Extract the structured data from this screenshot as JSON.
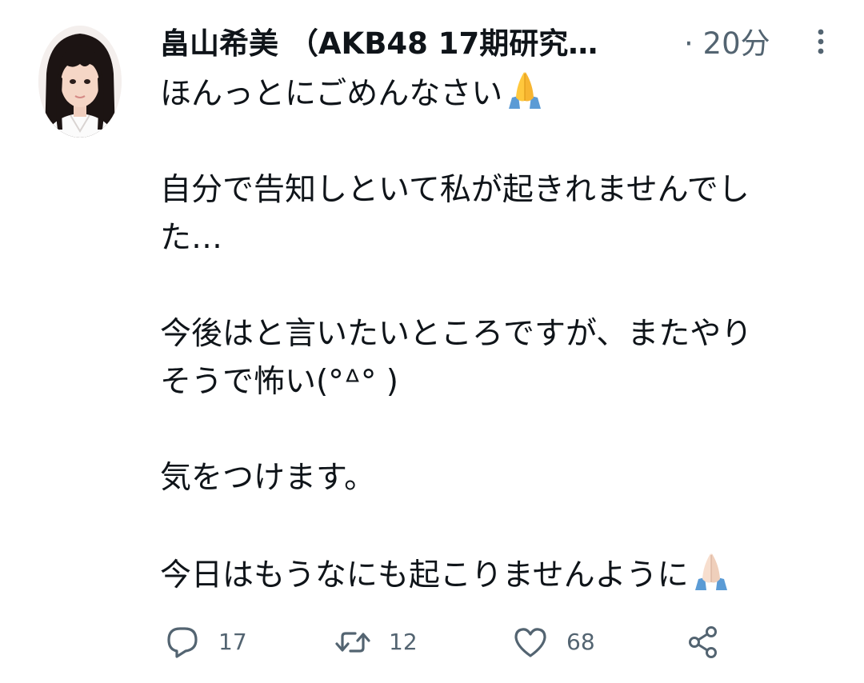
{
  "tweet": {
    "display_name": "畠山希美 （AKB48 17期研究…",
    "timestamp": "· 20分",
    "lines": [
      "ほんっとにごめんなさい",
      "",
      "自分で告知しといて私が起きれませんでし",
      "た…",
      "",
      "今後はと言いたいところですが、またやり",
      "そうで怖い(°ᐞ° )",
      "",
      "気をつけます。",
      "",
      "今日はもうなにも起こりませんように"
    ]
  },
  "actions": {
    "reply_count": "17",
    "retweet_count": "12",
    "like_count": "68"
  },
  "icons": {
    "more": "more-vertical-icon",
    "reply": "reply-icon",
    "retweet": "retweet-icon",
    "like": "heart-icon",
    "share": "share-icon",
    "emoji_1": "folded-hands-emoji",
    "emoji_2": "folded-hands-light-skin-emoji"
  },
  "colors": {
    "text_primary": "#0f1419",
    "text_secondary": "#536471",
    "emoji_sleeve": "#5b9bd5",
    "emoji_skin_1": "#ffc83d",
    "emoji_skin_2": "#f7dece"
  }
}
